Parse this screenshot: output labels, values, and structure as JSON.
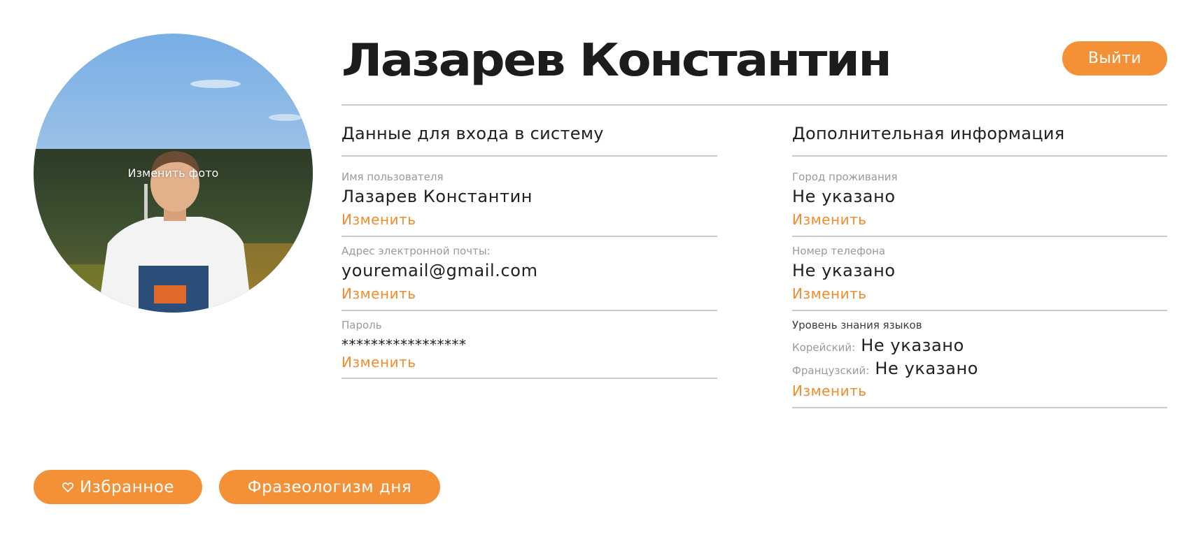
{
  "profile": {
    "name": "Лазарев Константин",
    "avatar_caption": "Изменить фото",
    "logout_label": "Выйти"
  },
  "login_section": {
    "title": "Данные для входа в систему",
    "username": {
      "label": "Имя пользователя",
      "value": "Лазарев Константин",
      "action": "Изменить"
    },
    "email": {
      "label": "Адрес электронной почты:",
      "value": "youremail@gmail.com",
      "action": "Изменить"
    },
    "password": {
      "label": "Пароль",
      "value": "*****************",
      "action": "Изменить"
    }
  },
  "extra_section": {
    "title": "Дополнительная информация",
    "city": {
      "label": "Город проживания",
      "value": "Не указано",
      "action": "Изменить"
    },
    "phone": {
      "label": "Номер телефона",
      "value": "Не указано",
      "action": "Изменить"
    },
    "languages": {
      "label": "Уровень знания языков",
      "items": [
        {
          "name": "Корейский:",
          "value": "Не указано"
        },
        {
          "name": "Французский:",
          "value": "Не указано"
        }
      ],
      "action": "Изменить"
    }
  },
  "bottom_buttons": {
    "favorites_label": "Избранное",
    "favorites_icon": "heart-icon",
    "phrase_label": "Фразеологизм дня"
  },
  "colors": {
    "accent": "#f49035",
    "link": "#f08c2e",
    "divider": "#c9c9c9",
    "text": "#1f1f1f",
    "muted": "#9a9a9a"
  }
}
